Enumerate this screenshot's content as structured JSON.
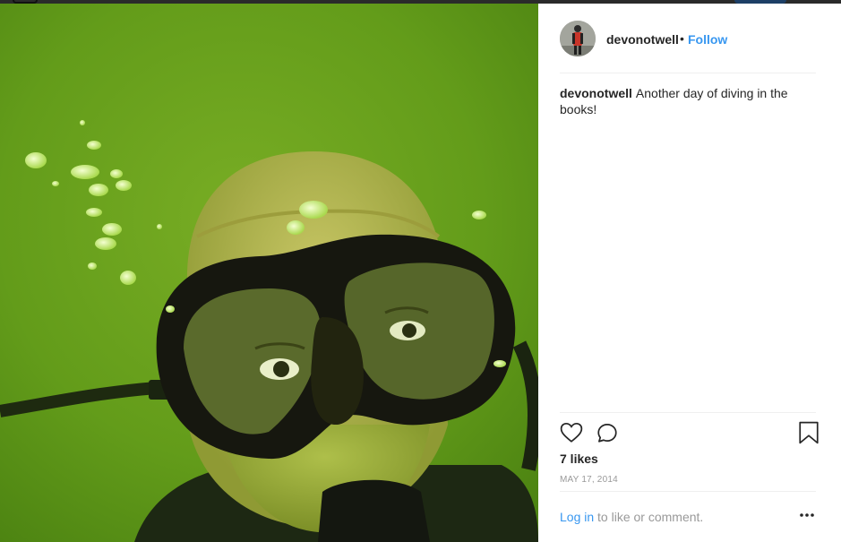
{
  "post": {
    "username": "devonotwell",
    "separator": "•",
    "follow_label": "Follow",
    "caption_user": "devonotwell",
    "caption_text": "Another day of diving in the books!",
    "likes": "7 likes",
    "date": "MAY 17, 2014",
    "login_link": "Log in",
    "login_suffix": " to like or comment."
  },
  "icons": {
    "like": "heart-icon",
    "comment": "comment-bubble-icon",
    "save": "bookmark-icon",
    "more": "ellipsis-icon"
  },
  "colors": {
    "accent": "#3897f0",
    "text": "#262626",
    "muted": "#999999",
    "water": "#6aa01c"
  }
}
